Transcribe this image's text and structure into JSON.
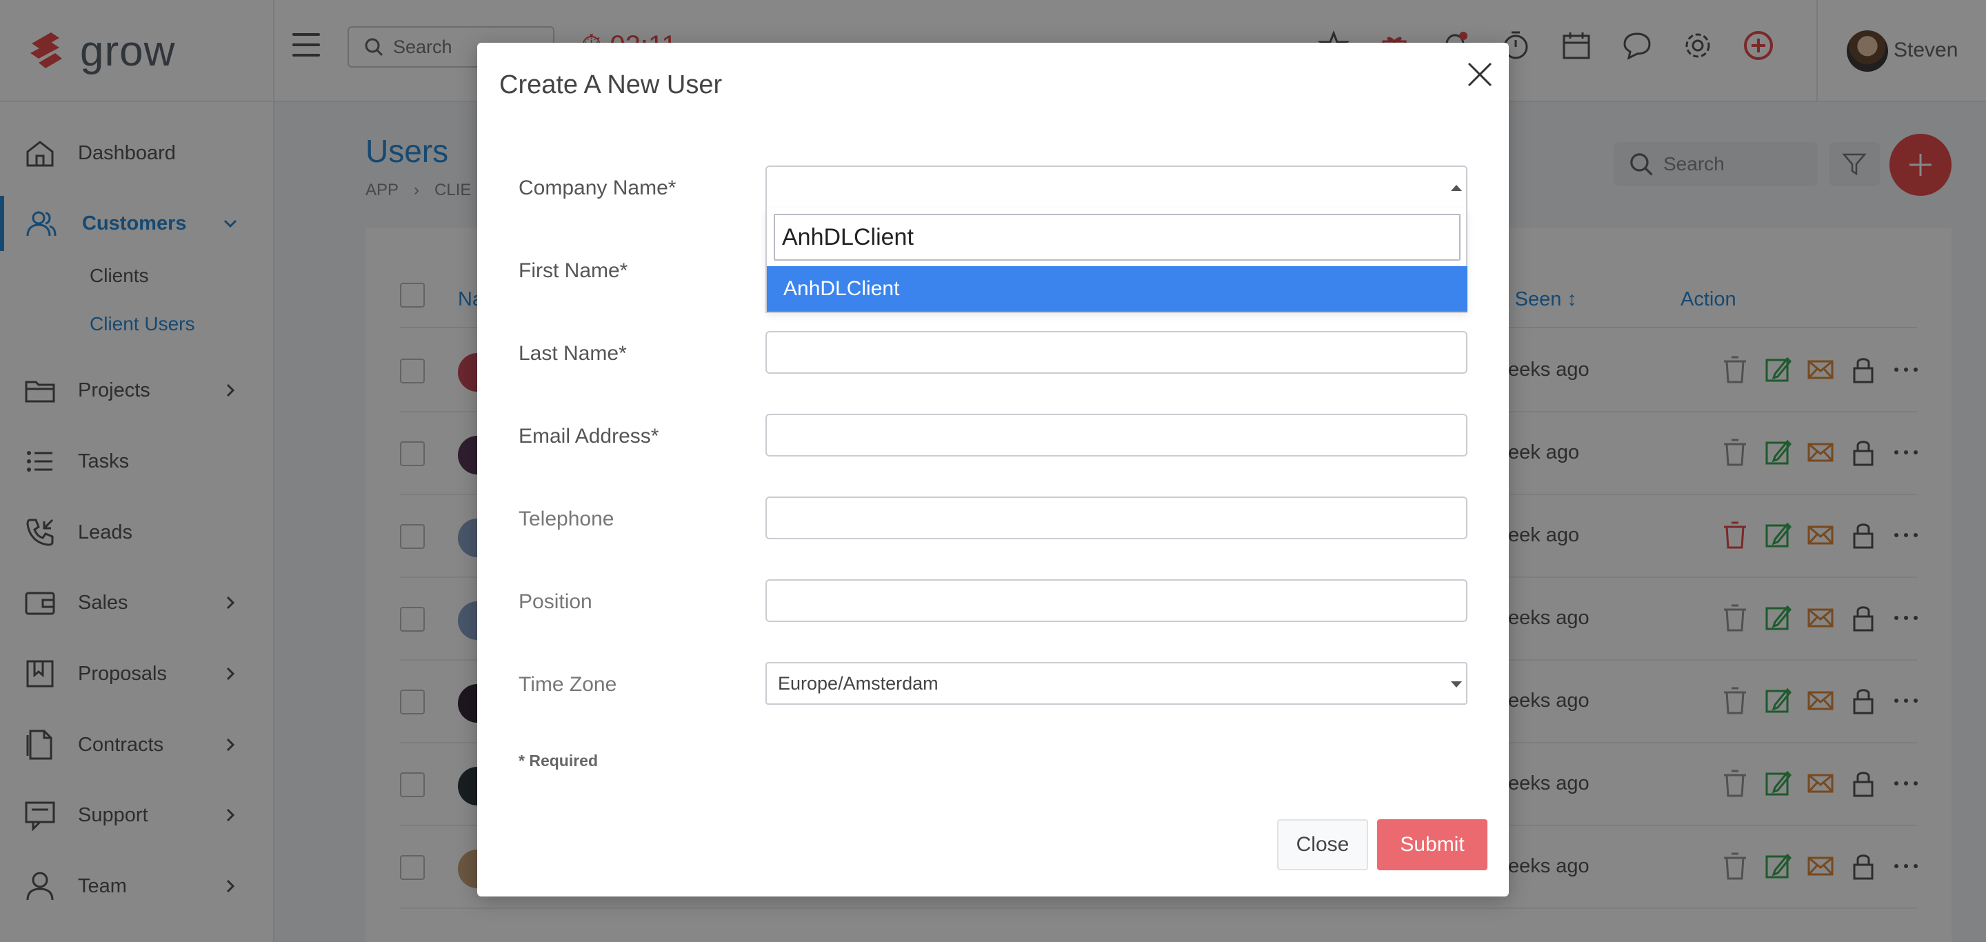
{
  "brand": {
    "name": "grow",
    "accent": "#e84c4c",
    "primary": "#2a8bd8"
  },
  "topbar": {
    "search_label": "Search",
    "timer": "02:11",
    "user_name": "Steven",
    "icons": [
      "star-icon",
      "gift-icon",
      "bell-icon",
      "stopwatch-icon",
      "calendar-icon",
      "chat-icon",
      "gear-icon",
      "add-circle-icon"
    ]
  },
  "sidebar": {
    "items": [
      {
        "label": "Dashboard",
        "icon": "home-icon"
      },
      {
        "label": "Customers",
        "icon": "users-icon",
        "active": true,
        "expanded": true
      },
      {
        "label": "Projects",
        "icon": "folder-icon"
      },
      {
        "label": "Tasks",
        "icon": "list-icon"
      },
      {
        "label": "Leads",
        "icon": "phone-icon"
      },
      {
        "label": "Sales",
        "icon": "wallet-icon"
      },
      {
        "label": "Proposals",
        "icon": "bookmark-icon"
      },
      {
        "label": "Contracts",
        "icon": "document-icon"
      },
      {
        "label": "Support",
        "icon": "support-icon"
      },
      {
        "label": "Team",
        "icon": "user-icon"
      }
    ],
    "sub_items": [
      {
        "label": "Clients"
      },
      {
        "label": "Client Users",
        "active": true
      }
    ]
  },
  "main": {
    "title": "Users",
    "breadcrumb": [
      "APP",
      "CLIE"
    ],
    "search_label": "Search",
    "table": {
      "headers": {
        "name": "Na",
        "last_seen": "st Seen ↕",
        "action": "Action"
      },
      "rows": [
        {
          "seen": "weeks ago"
        },
        {
          "seen": "week ago"
        },
        {
          "seen": "week ago"
        },
        {
          "seen": "weeks ago"
        },
        {
          "seen": "weeks ago"
        },
        {
          "seen": "weeks ago"
        },
        {
          "seen": "weeks ago"
        }
      ]
    }
  },
  "modal": {
    "title": "Create A New User",
    "fields": {
      "company_name": "Company Name*",
      "first_name": "First Name*",
      "last_name": "Last Name*",
      "email": "Email Address*",
      "telephone": "Telephone",
      "position": "Position",
      "time_zone": "Time Zone"
    },
    "company_search_value": "AnhDLClient",
    "company_option": "AnhDLClient",
    "time_zone_value": "Europe/Amsterdam",
    "required_note": "* Required",
    "close_label": "Close",
    "submit_label": "Submit"
  }
}
